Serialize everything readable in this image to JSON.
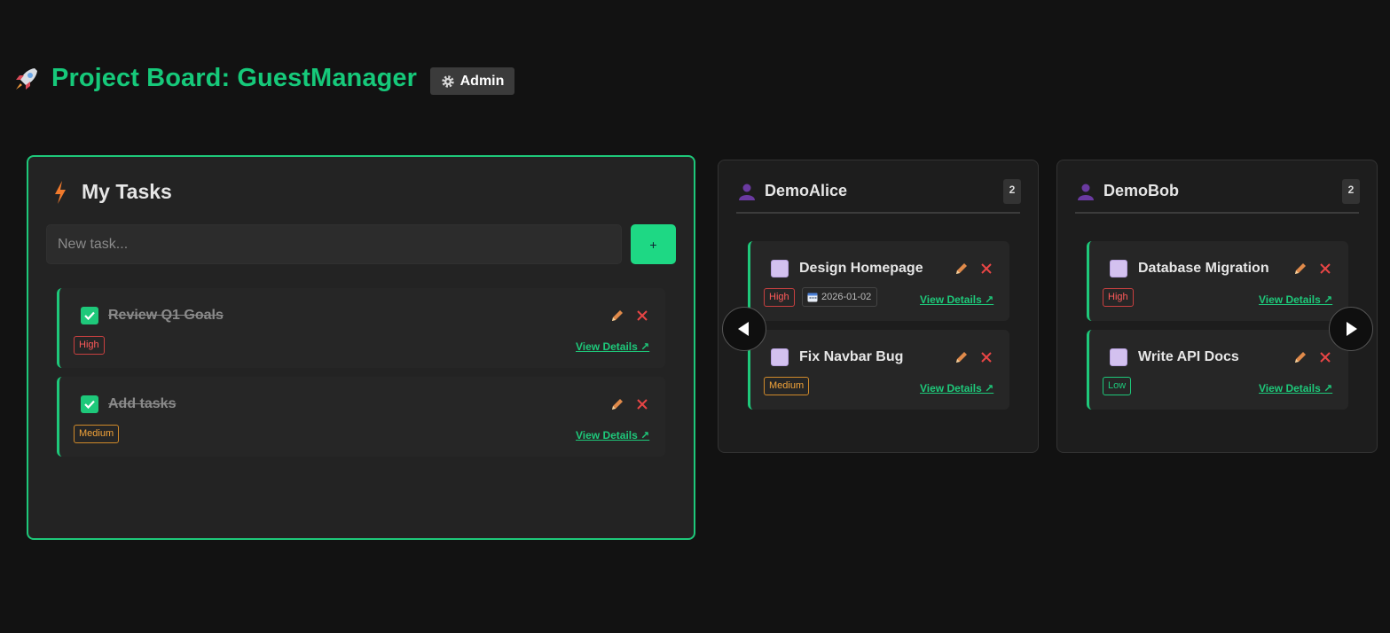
{
  "header": {
    "title": "Project Board: GuestManager",
    "admin_label": "Admin",
    "rocket_icon": "rocket-icon",
    "gear_icon": "gear-icon"
  },
  "my_tasks": {
    "title": "My Tasks",
    "new_task_placeholder": "New task...",
    "add_label": "+",
    "tasks": [
      {
        "title": "Review Q1 Goals",
        "done": true,
        "priority": "High",
        "view_label": "View Details ↗"
      },
      {
        "title": "Add tasks",
        "done": true,
        "priority": "Medium",
        "view_label": "View Details ↗"
      }
    ]
  },
  "members": [
    {
      "name": "DemoAlice",
      "count": "2",
      "tasks": [
        {
          "title": "Design Homepage",
          "done": false,
          "priority": "High",
          "date": "2026-01-02",
          "view_label": "View Details ↗"
        },
        {
          "title": "Fix Navbar Bug",
          "done": false,
          "priority": "Medium",
          "view_label": "View Details ↗"
        }
      ]
    },
    {
      "name": "DemoBob",
      "count": "2",
      "tasks": [
        {
          "title": "Database Migration",
          "done": false,
          "priority": "High",
          "view_label": "View Details ↗"
        },
        {
          "title": "Write API Docs",
          "done": false,
          "priority": "Low",
          "view_label": "View Details ↗"
        }
      ]
    }
  ],
  "colors": {
    "accent": "#1ec87a",
    "background": "#121212",
    "high": "#ff5a5a",
    "medium": "#f3a43a",
    "low": "#1ec87a"
  }
}
